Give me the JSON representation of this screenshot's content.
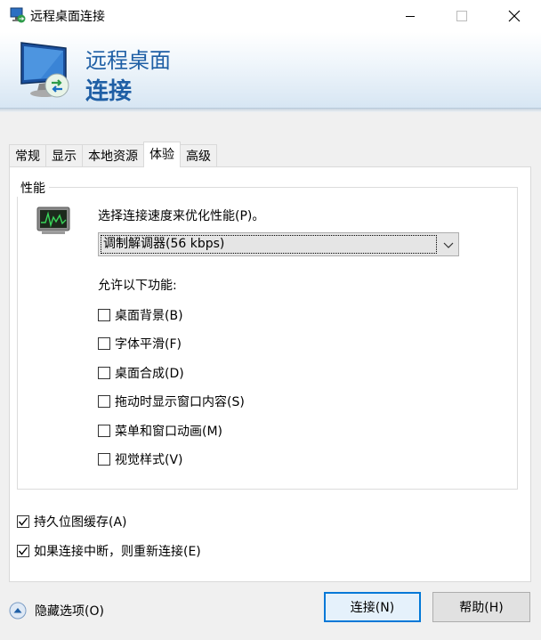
{
  "window": {
    "title": "远程桌面连接",
    "icon": "remote-desktop-icon"
  },
  "banner": {
    "line1": "远程桌面",
    "line2": "连接"
  },
  "tabs": [
    {
      "label": "常规",
      "active": false
    },
    {
      "label": "显示",
      "active": false
    },
    {
      "label": "本地资源",
      "active": false
    },
    {
      "label": "体验",
      "active": true
    },
    {
      "label": "高级",
      "active": false
    }
  ],
  "performance": {
    "group_label": "性能",
    "speed_label": "选择连接速度来优化性能(P)。",
    "speed_value": "调制解调器(56 kbps)",
    "allow_label": "允许以下功能:",
    "features": [
      {
        "label": "桌面背景(B)",
        "checked": false
      },
      {
        "label": "字体平滑(F)",
        "checked": false
      },
      {
        "label": "桌面合成(D)",
        "checked": false
      },
      {
        "label": "拖动时显示窗口内容(S)",
        "checked": false
      },
      {
        "label": "菜单和窗口动画(M)",
        "checked": false
      },
      {
        "label": "视觉样式(V)",
        "checked": false
      }
    ]
  },
  "options": [
    {
      "label": "持久位图缓存(A)",
      "checked": true
    },
    {
      "label": "如果连接中断，则重新连接(E)",
      "checked": true
    }
  ],
  "footer": {
    "hide_options_label": "隐藏选项(O)",
    "connect_label": "连接(N)",
    "help_label": "帮助(H)"
  },
  "colors": {
    "accent": "#0078d7",
    "banner_text": "#1f5fa5"
  }
}
